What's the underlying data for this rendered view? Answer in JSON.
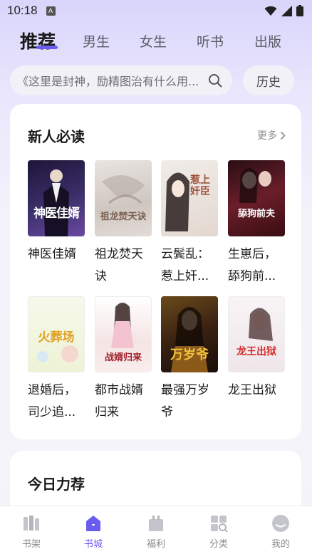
{
  "status_bar": {
    "time": "10:18",
    "notif_glyph": "A"
  },
  "top_tabs": [
    {
      "label": "推荐",
      "active": true
    },
    {
      "label": "男生",
      "active": false
    },
    {
      "label": "女生",
      "active": false
    },
    {
      "label": "听书",
      "active": false
    },
    {
      "label": "出版",
      "active": false
    }
  ],
  "search": {
    "placeholder": "《这里是封神，励精图治有什么用...",
    "history_label": "历史"
  },
  "section_new": {
    "title": "新人必读",
    "more_label": "更多",
    "books": [
      {
        "title": "神医佳婿",
        "cover_text": "神医佳婿",
        "cover_bg": "#2a1f4a",
        "cover_fg": "#ffffff"
      },
      {
        "title": "祖龙焚天诀",
        "cover_text": "祖龙焚天诀",
        "cover_bg": "#d9d3cf",
        "cover_fg": "#8a7060"
      },
      {
        "title": "云鬓乱：惹上奸...",
        "cover_text": "惹上奸臣",
        "cover_bg": "#e9e2dc",
        "cover_fg": "#a0523a"
      },
      {
        "title": "生崽后，舔狗前...",
        "cover_text": "舔狗前夫",
        "cover_bg": "#5a1a24",
        "cover_fg": "#ffffff"
      },
      {
        "title": "退婚后，司少追...",
        "cover_text": "火葬场",
        "cover_bg": "#eef3d8",
        "cover_fg": "#e0a020"
      },
      {
        "title": "都市战婿归来",
        "cover_text": "战婿归来",
        "cover_bg": "#f2dede",
        "cover_fg": "#a0202a"
      },
      {
        "title": "最强万岁爷",
        "cover_text": "万岁爷",
        "cover_bg": "#3a2418",
        "cover_fg": "#f0c040"
      },
      {
        "title": "龙王出狱",
        "cover_text": "龙王出狱",
        "cover_bg": "#f3eef0",
        "cover_fg": "#d42a2a"
      }
    ]
  },
  "section_today": {
    "title": "今日力荐"
  },
  "bottom_nav": [
    {
      "label": "书架",
      "icon": "bookshelf-icon",
      "active": false
    },
    {
      "label": "书城",
      "icon": "bookstore-icon",
      "active": true
    },
    {
      "label": "福利",
      "icon": "gift-icon",
      "active": false
    },
    {
      "label": "分类",
      "icon": "category-icon",
      "active": false
    },
    {
      "label": "我的",
      "icon": "profile-icon",
      "active": false
    }
  ],
  "colors": {
    "accent": "#6b5cf0",
    "inactive": "#8a8a92"
  }
}
